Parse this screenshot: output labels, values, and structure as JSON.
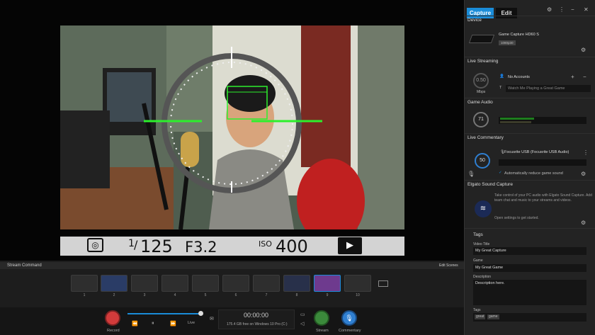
{
  "preview": {
    "shutter_num": "1",
    "shutter_den": "125",
    "aperture": "F3.2",
    "iso_label": "ISO",
    "iso_value": "400",
    "exposure_icon": "metering-icon",
    "camera_icon": "movie-camera-icon"
  },
  "panel": {
    "tabs": [
      {
        "label": "Capture"
      },
      {
        "label": "Edit"
      }
    ],
    "device": {
      "title": "Device",
      "name": "Game Capture HD60 S",
      "badge": "1080p30"
    },
    "live_streaming": {
      "title": "Live Streaming",
      "account": "No Accounts",
      "knob": "0.50",
      "knob_unit": "Mbps",
      "title_placeholder": "Watch Me Playing a Great Game"
    },
    "game_audio": {
      "title": "Game Audio",
      "knob": "71"
    },
    "live_commentary": {
      "title": "Live Commentary",
      "knob": "50",
      "mic": "Focusrite USB (Focusrite USB Audio)",
      "reduce_label": "Automatically reduce game sound"
    },
    "sound_capture": {
      "title": "Elgato Sound Capture",
      "text": "Take control of your PC audio with Elgato Sound Capture. Add team chat and music to your streams and videos.",
      "link": "Open settings to get started."
    },
    "tags": {
      "title": "Tags",
      "video_title_label": "Video Title",
      "video_title": "My Great Capture",
      "game_label": "Game",
      "game": "My Great Game",
      "description_label": "Description",
      "description": "Description here.",
      "tags_label": "Tags",
      "tag_items": [
        "great",
        "game"
      ]
    }
  },
  "stream_command": {
    "title": "Stream Command",
    "edit_scenes": "Edit Scenes",
    "scenes": [
      "1",
      "2",
      "3",
      "4",
      "5",
      "6",
      "7",
      "8",
      "9",
      "10"
    ],
    "record_label": "Record",
    "rewind": "⏪",
    "play": "⏸",
    "ff": "⏩",
    "live": "Live",
    "timer": "00:00:00",
    "disk": "175.4 GB free on Windows 10 Pro (C:)",
    "stream_label": "Stream",
    "commentary_label": "Commentary"
  },
  "colors": {
    "accent": "#1a8cd8",
    "record": "#d23b3b",
    "stream": "#3b8a3b",
    "commentary": "#2f7fd1",
    "focus": "#2cf02c"
  }
}
